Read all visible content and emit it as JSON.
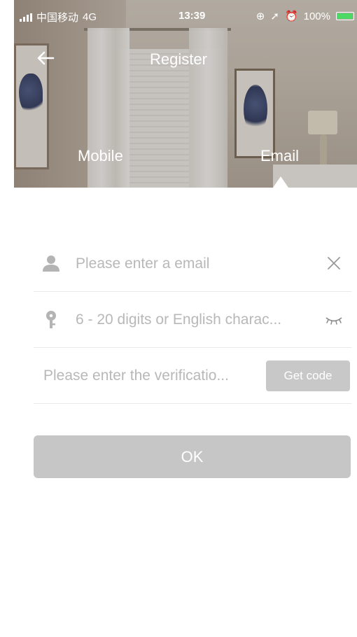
{
  "status_bar": {
    "carrier": "中国移动",
    "network": "4G",
    "time": "13:39",
    "battery": "100%",
    "battery_fill": 1.0
  },
  "header": {
    "title": "Register",
    "back_icon": "arrow-left-icon"
  },
  "tabs": [
    {
      "label": "Mobile",
      "active": false
    },
    {
      "label": "Email",
      "active": true
    }
  ],
  "form": {
    "email_placeholder": "Please enter a email",
    "password_placeholder": "6 - 20 digits or English charac...",
    "code_placeholder": "Please enter the verificatio...",
    "get_code_label": "Get code",
    "ok_label": "OK"
  },
  "colors": {
    "placeholder": "#b8b8b8",
    "button_disabled": "#c6c6c6",
    "battery": "#4cd964"
  }
}
